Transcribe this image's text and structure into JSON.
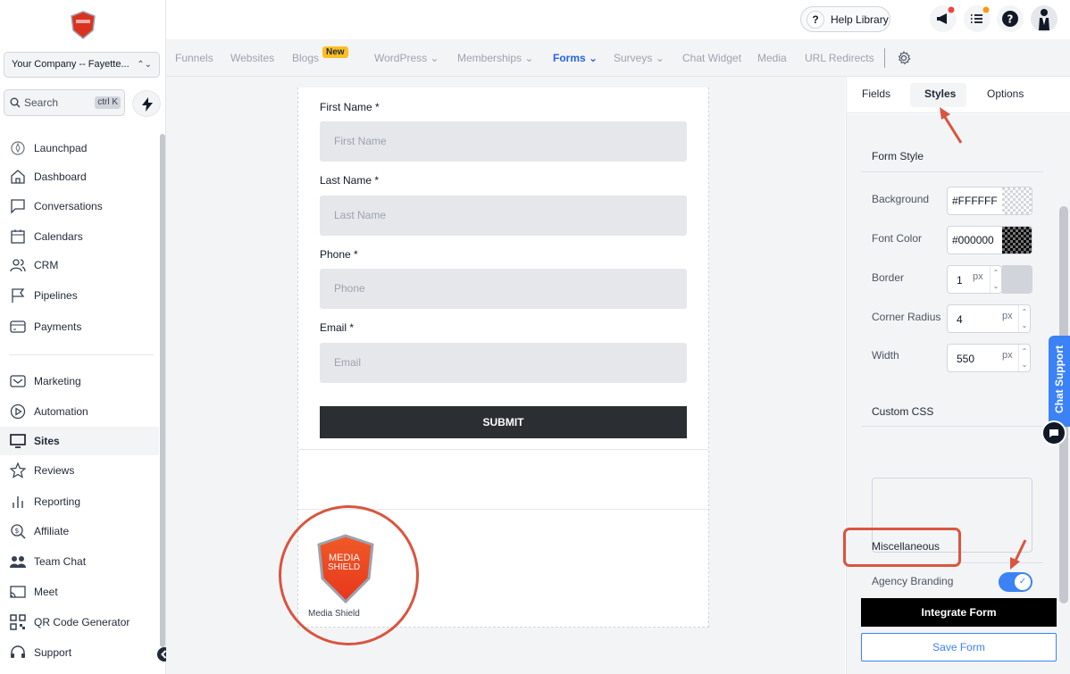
{
  "sidebar": {
    "company": "Your Company -- Fayette...",
    "search_placeholder": "Search",
    "search_shortcut": "ctrl K",
    "items": [
      {
        "label": "Launchpad"
      },
      {
        "label": "Dashboard"
      },
      {
        "label": "Conversations"
      },
      {
        "label": "Calendars"
      },
      {
        "label": "CRM"
      },
      {
        "label": "Pipelines"
      },
      {
        "label": "Payments"
      },
      {
        "label": "Marketing"
      },
      {
        "label": "Automation"
      },
      {
        "label": "Sites"
      },
      {
        "label": "Reviews"
      },
      {
        "label": "Reporting"
      },
      {
        "label": "Affiliate"
      },
      {
        "label": "Team Chat"
      },
      {
        "label": "Meet"
      },
      {
        "label": "QR Code Generator"
      },
      {
        "label": "Support"
      }
    ]
  },
  "topbar": {
    "help_label": "Help Library"
  },
  "tabs": {
    "items": [
      "Funnels",
      "Websites",
      "Blogs",
      "WordPress",
      "Memberships",
      "Forms",
      "Surveys",
      "Chat Widget",
      "Media",
      "URL Redirects"
    ],
    "new_badge": "New",
    "active": "Forms"
  },
  "form": {
    "fields": [
      {
        "label": "First Name *",
        "placeholder": "First Name"
      },
      {
        "label": "Last Name *",
        "placeholder": "Last Name"
      },
      {
        "label": "Phone *",
        "placeholder": "Phone"
      },
      {
        "label": "Email *",
        "placeholder": "Email"
      }
    ],
    "submit_label": "SUBMIT",
    "branding_name": "Media Shield",
    "brand_logo_text": [
      "MEDIA",
      "SHIELD"
    ]
  },
  "panel": {
    "tabs": [
      "Fields",
      "Styles",
      "Options"
    ],
    "active_tab": "Styles",
    "form_style_title": "Form Style",
    "background_label": "Background",
    "background_value": "#FFFFFF",
    "font_color_label": "Font Color",
    "font_color_value": "#000000",
    "border_label": "Border",
    "border_value": "1",
    "corner_radius_label": "Corner Radius",
    "corner_radius_value": "4",
    "width_label": "Width",
    "width_value": "550",
    "unit": "px",
    "custom_css_title": "Custom CSS",
    "misc_title": "Miscellaneous",
    "agency_branding_label": "Agency Branding",
    "agency_branding_on": true,
    "integrate_label": "Integrate Form",
    "save_label": "Save Form"
  },
  "chat_support_label": "Chat Support",
  "colors": {
    "accent": "#2563eb",
    "annotation": "#d9553f",
    "submit_bg": "#2b2f33",
    "brand_red": "#e8361c"
  }
}
